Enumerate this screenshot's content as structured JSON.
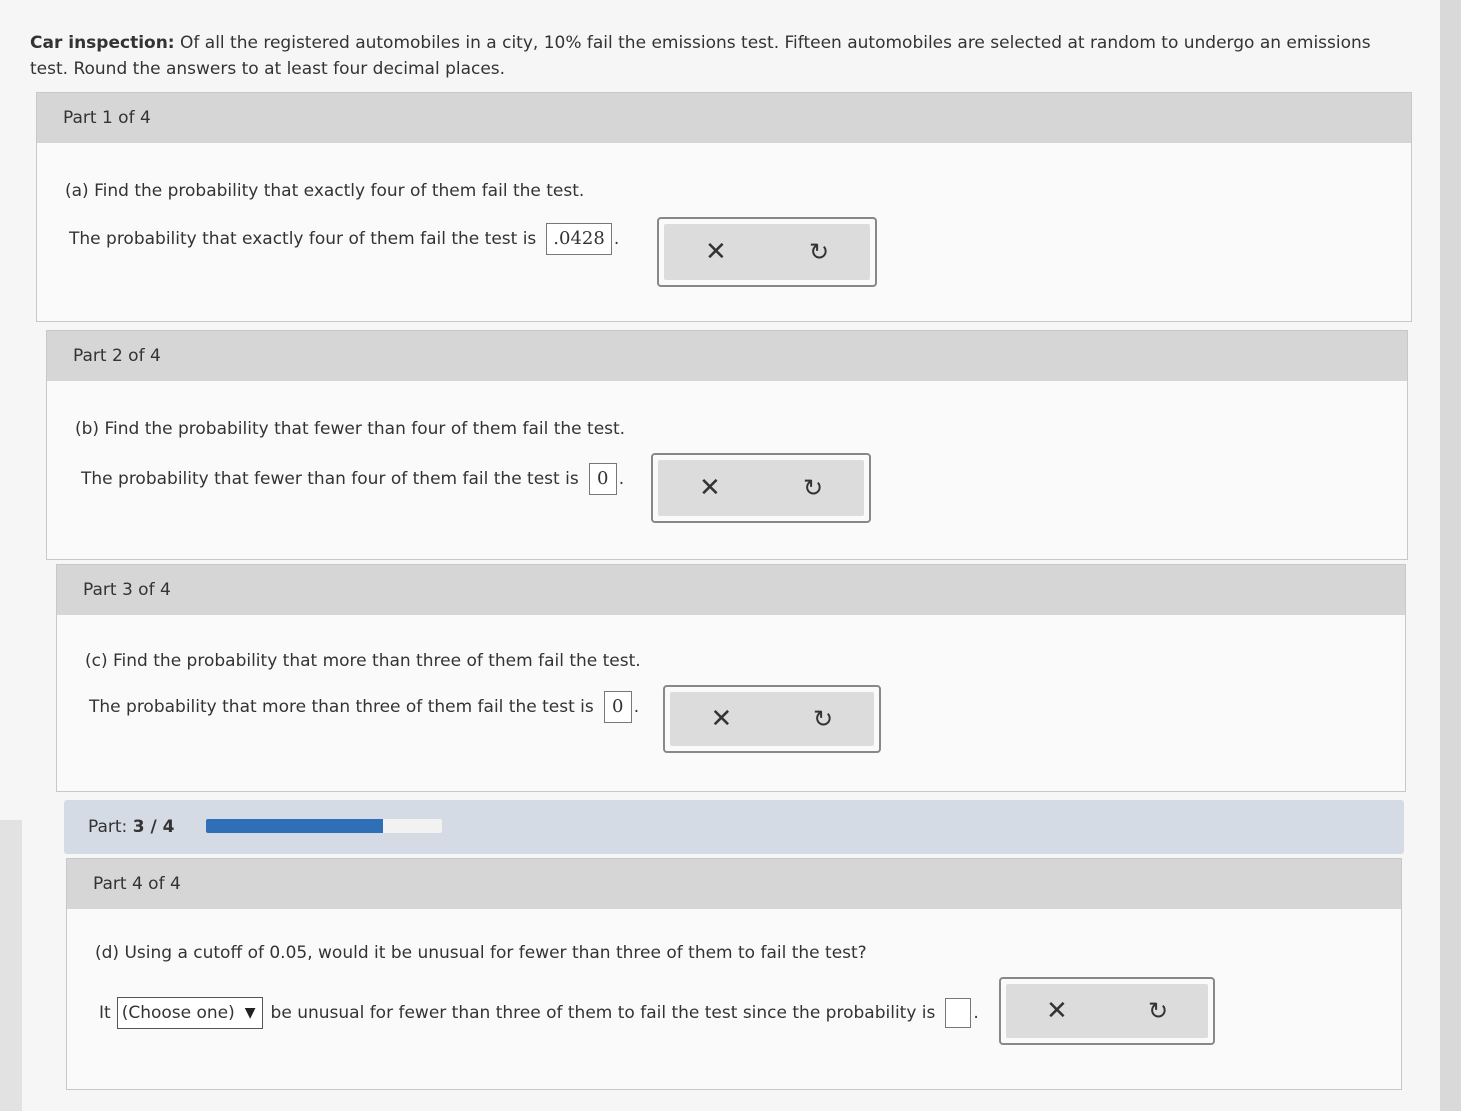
{
  "problem": {
    "title": "Car inspection:",
    "text": " Of all the registered automobiles in a city, 10% fail the emissions test. Fifteen automobiles are selected at random to undergo an emissions test. Round the answers to at least four decimal places."
  },
  "parts": [
    {
      "header": "Part 1 of 4",
      "question": "(a) Find the probability that exactly four of them fail the test.",
      "answer_prefix": "The probability that exactly four of them fail the test is",
      "answer_value": ".0428"
    },
    {
      "header": "Part 2 of 4",
      "question": "(b) Find the probability that fewer than four of them fail the test.",
      "answer_prefix": "The probability that fewer than four of them fail the test is",
      "answer_value": "0"
    },
    {
      "header": "Part 3 of 4",
      "question": "(c) Find the probability that more than three of them fail the test.",
      "answer_prefix": "The probability that more than three of them fail the test is",
      "answer_value": "0"
    },
    {
      "header": "Part 4 of 4",
      "question": "(d) Using a cutoff of 0.05, would it be unusual for fewer than three of them to fail the test?",
      "answer_lead": "It",
      "select_value": "(Choose one)",
      "answer_suffix": "be unusual for fewer than three of them to fail the test since the probability is",
      "answer_value": ""
    }
  ],
  "progress": {
    "label": "Part:",
    "value_text": "3 / 4",
    "fraction": 0.75
  },
  "punctuation": {
    "period": "."
  },
  "icons": {
    "clear": "close-icon",
    "undo": "undo-icon",
    "dropdown": "triangle-down-icon"
  },
  "colors": {
    "progress_fill": "#2f6fb8",
    "header_bg": "#d6d6d6"
  }
}
